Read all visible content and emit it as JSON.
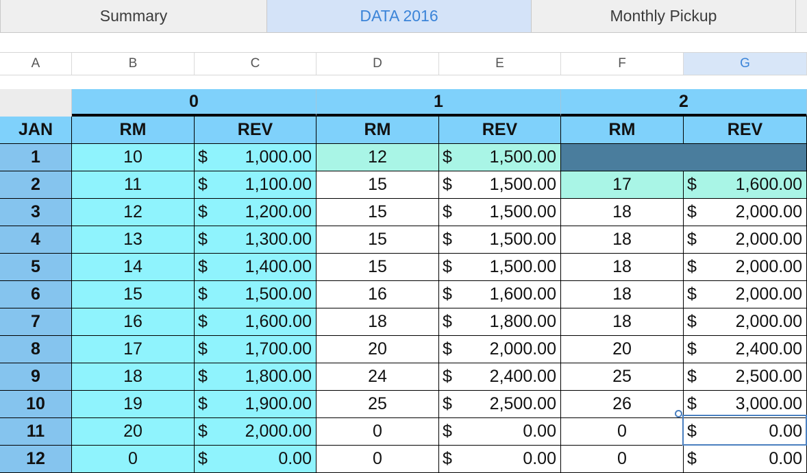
{
  "tabs": [
    {
      "label": "Summary",
      "active": false
    },
    {
      "label": "DATA 2016",
      "active": true
    },
    {
      "label": "Monthly Pickup",
      "active": false
    }
  ],
  "column_letters": [
    "A",
    "B",
    "C",
    "D",
    "E",
    "F",
    "G"
  ],
  "selected_column": "G",
  "groups": [
    "0",
    "1",
    "2"
  ],
  "row_label_header": "JAN",
  "sub_headers": [
    "RM",
    "REV"
  ],
  "currency_symbol": "$",
  "rows": [
    {
      "label": "1",
      "cells": [
        "10",
        "1,000.00",
        "12",
        "1,500.00",
        "",
        ""
      ]
    },
    {
      "label": "2",
      "cells": [
        "11",
        "1,100.00",
        "15",
        "1,500.00",
        "17",
        "1,600.00"
      ]
    },
    {
      "label": "3",
      "cells": [
        "12",
        "1,200.00",
        "15",
        "1,500.00",
        "18",
        "2,000.00"
      ]
    },
    {
      "label": "4",
      "cells": [
        "13",
        "1,300.00",
        "15",
        "1,500.00",
        "18",
        "2,000.00"
      ]
    },
    {
      "label": "5",
      "cells": [
        "14",
        "1,400.00",
        "15",
        "1,500.00",
        "18",
        "2,000.00"
      ]
    },
    {
      "label": "6",
      "cells": [
        "15",
        "1,500.00",
        "16",
        "1,600.00",
        "18",
        "2,000.00"
      ]
    },
    {
      "label": "7",
      "cells": [
        "16",
        "1,600.00",
        "18",
        "1,800.00",
        "18",
        "2,000.00"
      ]
    },
    {
      "label": "8",
      "cells": [
        "17",
        "1,700.00",
        "20",
        "2,000.00",
        "20",
        "2,400.00"
      ]
    },
    {
      "label": "9",
      "cells": [
        "18",
        "1,800.00",
        "24",
        "2,400.00",
        "25",
        "2,500.00"
      ]
    },
    {
      "label": "10",
      "cells": [
        "19",
        "1,900.00",
        "25",
        "2,500.00",
        "26",
        "3,000.00"
      ]
    },
    {
      "label": "11",
      "cells": [
        "20",
        "2,000.00",
        "0",
        "0.00",
        "0",
        "0.00"
      ]
    },
    {
      "label": "12",
      "cells": [
        "0",
        "0.00",
        "0",
        "0.00",
        "0",
        "0.00"
      ]
    }
  ],
  "colors": {
    "group_header_bg": "#7fd1fb",
    "col0_bg": "#8ff3fd",
    "highlight_bg": "#a9f5e6",
    "dark_fill": "#4a7d9d",
    "row_label_bg": "#85c4ee",
    "tab_active_bg": "#d4e3f8",
    "accent": "#3b84d8"
  }
}
